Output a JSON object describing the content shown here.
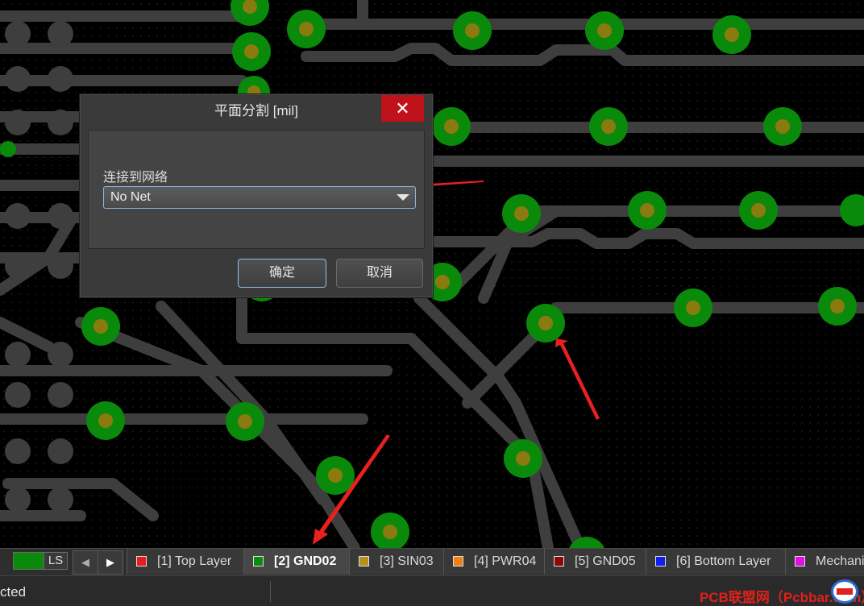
{
  "dialog": {
    "title": "平面分割 [mil]",
    "close_glyph": "✕",
    "net_label": "连接到网络",
    "net_value": "No Net",
    "ok_label": "确定",
    "cancel_label": "取消"
  },
  "layer_bar": {
    "ls_label": "LS",
    "ls_color": "#0a8a0a",
    "prev_glyph": "◀",
    "next_glyph": "▶",
    "tabs": [
      {
        "label": "[1] Top Layer",
        "color": "#e81c1c",
        "active": false
      },
      {
        "label": "[2] GND02",
        "color": "#0e8a0e",
        "active": true
      },
      {
        "label": "[3] SIN03",
        "color": "#b8901c",
        "active": false
      },
      {
        "label": "[4] PWR04",
        "color": "#f08010",
        "active": false
      },
      {
        "label": "[5] GND05",
        "color": "#8a0a0a",
        "active": false
      },
      {
        "label": "[6] Bottom Layer",
        "color": "#1020f0",
        "active": false
      },
      {
        "label": "Mechanical",
        "color": "#e010e0",
        "active": false
      }
    ]
  },
  "status_bar": {
    "text": "cted",
    "watermark": "PCB联盟网（Pcbbar.com）"
  },
  "colors": {
    "trace": "#3e3e3e",
    "pad": "#0a8a0a",
    "pad_hole": "#8a7a10",
    "annotation_arrow": "#e82020"
  },
  "icons": {
    "close": "close-icon",
    "dropdown": "chevron-down-icon",
    "prev": "scroll-left-icon",
    "next": "scroll-right-icon",
    "logo": "watermark-logo-icon"
  }
}
